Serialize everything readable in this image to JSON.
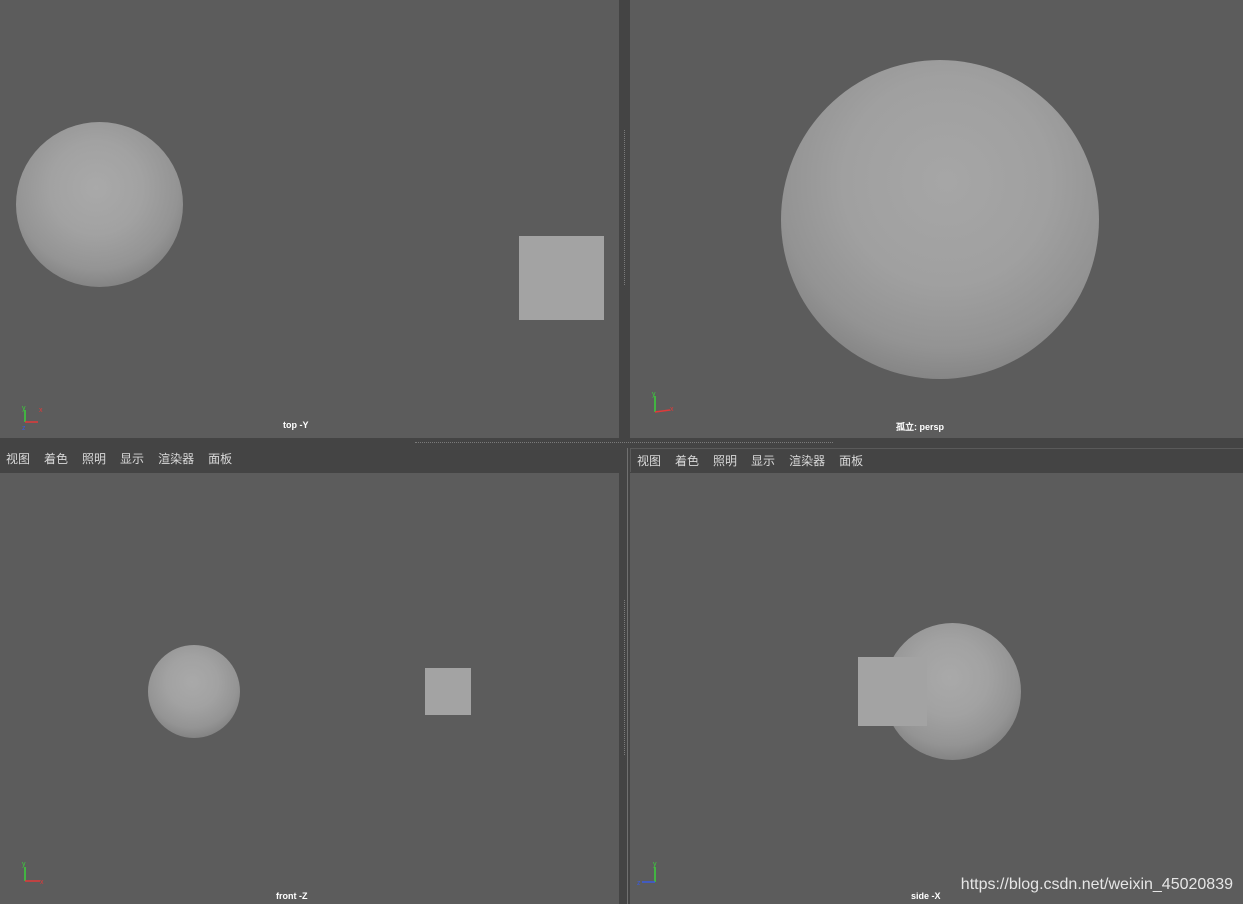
{
  "viewports": {
    "top": {
      "camera_label": "top -Y"
    },
    "persp": {
      "camera_label": "孤立: persp"
    },
    "front": {
      "camera_label": "front -Z"
    },
    "side": {
      "camera_label": "side -X"
    }
  },
  "panel_menu_left": {
    "items": [
      "视图",
      "着色",
      "照明",
      "显示",
      "渲染器",
      "面板"
    ]
  },
  "panel_menu_right": {
    "items": [
      "视图",
      "着色",
      "照明",
      "显示",
      "渲染器",
      "面板"
    ]
  },
  "axes": {
    "x_label": "x",
    "y_label": "y",
    "z_label": "z",
    "x_color": "#e03a3a",
    "y_color": "#3ad13a",
    "z_color": "#3a5be0"
  },
  "watermark": "https://blog.csdn.net/weixin_45020839",
  "colors": {
    "viewport_bg": "#5c5c5c",
    "ui_bg": "#444444",
    "object_gray": "#a3a3a3"
  }
}
